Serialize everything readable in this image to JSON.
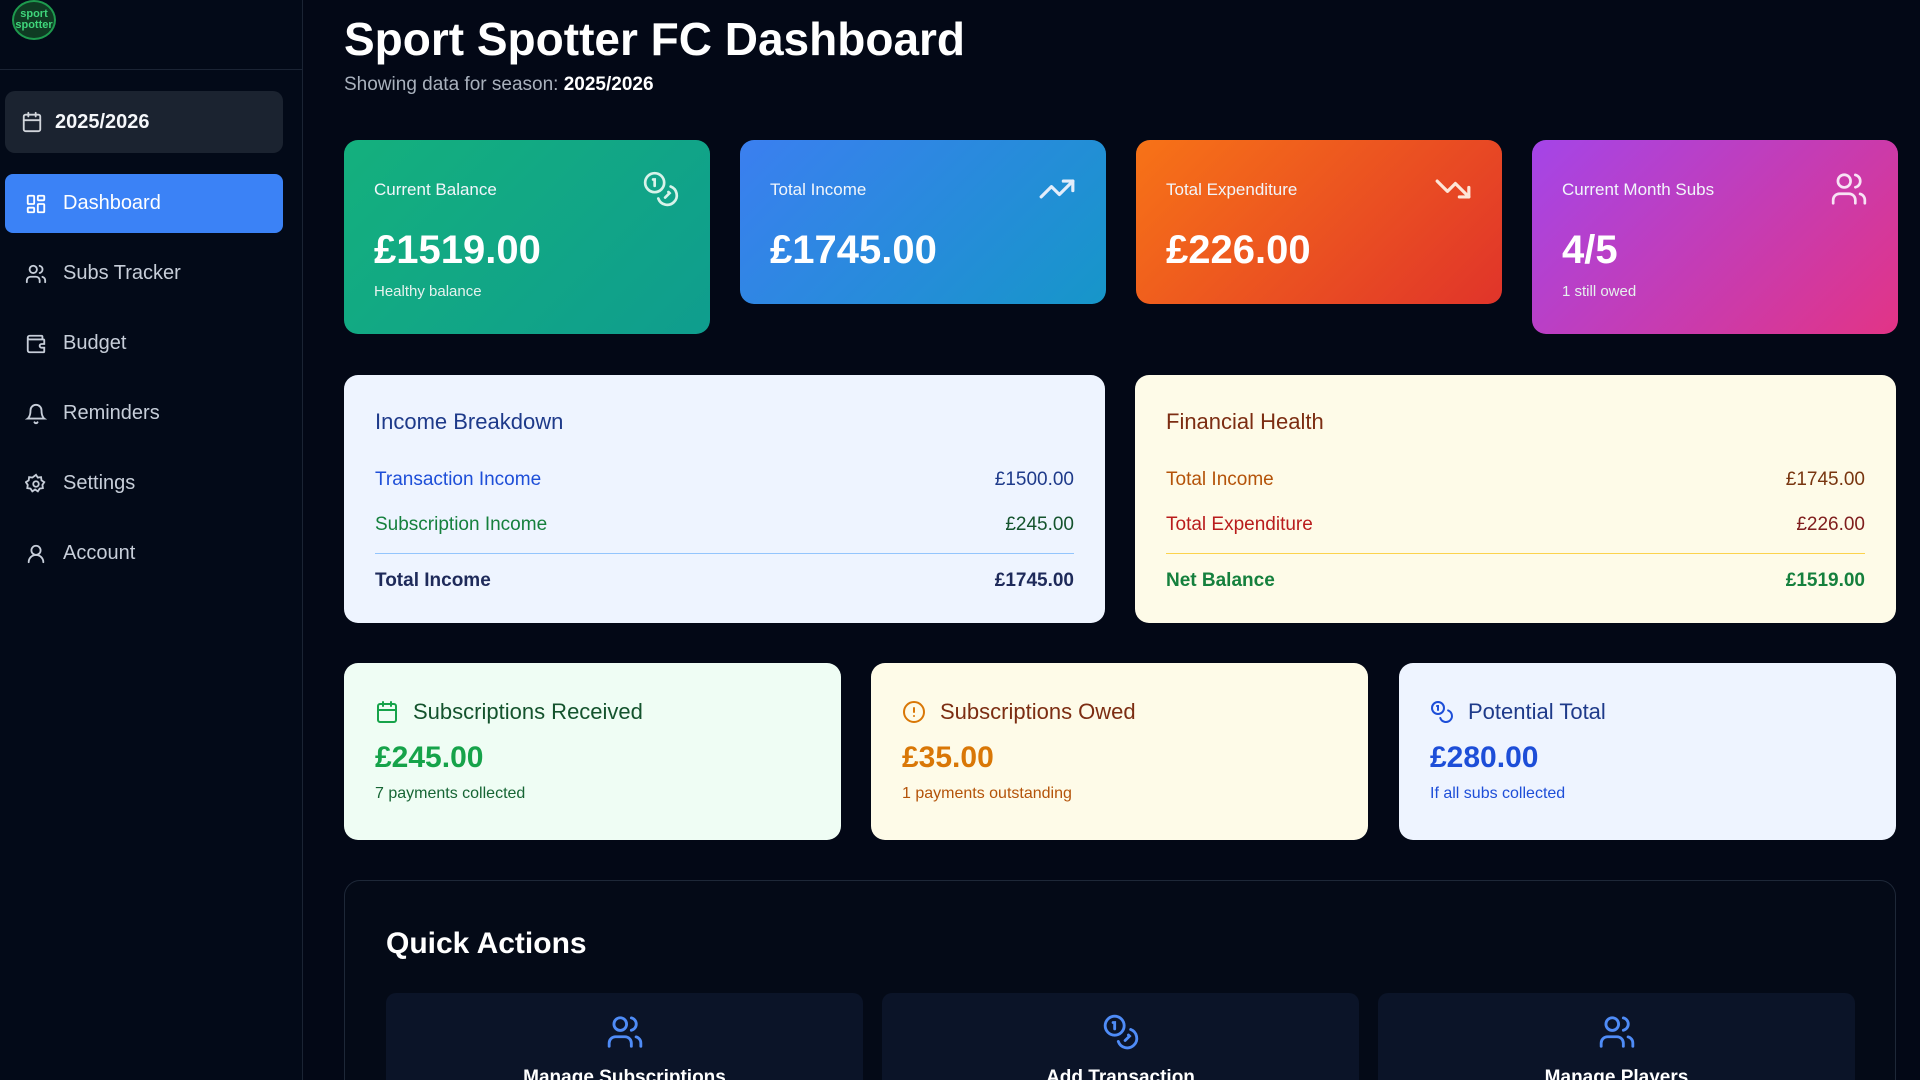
{
  "logo": {
    "line1": "sport",
    "line2": "spotter"
  },
  "season": {
    "label": "2025/2026"
  },
  "nav": [
    {
      "label": "Dashboard",
      "icon": "dashboard-icon",
      "active": true
    },
    {
      "label": "Subs Tracker",
      "icon": "users-icon"
    },
    {
      "label": "Budget",
      "icon": "wallet-icon"
    },
    {
      "label": "Reminders",
      "icon": "bell-icon"
    },
    {
      "label": "Settings",
      "icon": "gear-icon"
    },
    {
      "label": "Account",
      "icon": "user-icon"
    }
  ],
  "header": {
    "title": "Sport Spotter FC Dashboard",
    "subtitle_prefix": "Showing data for season: ",
    "subtitle_season": "2025/2026"
  },
  "stats": [
    {
      "label": "Current Balance",
      "value": "£1519.00",
      "note": "Healthy balance",
      "icon": "coins-icon"
    },
    {
      "label": "Total Income",
      "value": "£1745.00",
      "icon": "trending-up-icon"
    },
    {
      "label": "Total Expenditure",
      "value": "£226.00",
      "icon": "trending-down-icon"
    },
    {
      "label": "Current Month Subs",
      "value": "4/5",
      "note": "1 still owed",
      "icon": "users-icon"
    }
  ],
  "income_breakdown": {
    "title": "Income Breakdown",
    "rows": [
      {
        "label": "Transaction Income",
        "amount": "£1500.00"
      },
      {
        "label": "Subscription Income",
        "amount": "£245.00"
      }
    ],
    "total": {
      "label": "Total Income",
      "amount": "£1745.00"
    }
  },
  "financial_health": {
    "title": "Financial Health",
    "rows": [
      {
        "label": "Total Income",
        "amount": "£1745.00"
      },
      {
        "label": "Total Expenditure",
        "amount": "£226.00"
      }
    ],
    "total": {
      "label": "Net Balance",
      "amount": "£1519.00"
    }
  },
  "subs": [
    {
      "title": "Subscriptions Received",
      "value": "£245.00",
      "note": "7 payments collected",
      "icon": "calendar-icon"
    },
    {
      "title": "Subscriptions Owed",
      "value": "£35.00",
      "note": "1 payments outstanding",
      "icon": "alert-circle-icon"
    },
    {
      "title": "Potential Total",
      "value": "£280.00",
      "note": "If all subs collected",
      "icon": "coins-icon"
    }
  ],
  "quick_actions": {
    "title": "Quick Actions",
    "buttons": [
      {
        "label": "Manage Subscriptions",
        "icon": "users-icon"
      },
      {
        "label": "Add Transaction",
        "icon": "coins-icon"
      },
      {
        "label": "Manage Players",
        "icon": "users-icon"
      }
    ]
  },
  "colors": {
    "accent": "#3b82f6",
    "balance_card": "#14b07d",
    "income_card": "#3b7ff0",
    "expenditure_card": "#f77317",
    "subs_card": "#a445e8"
  }
}
